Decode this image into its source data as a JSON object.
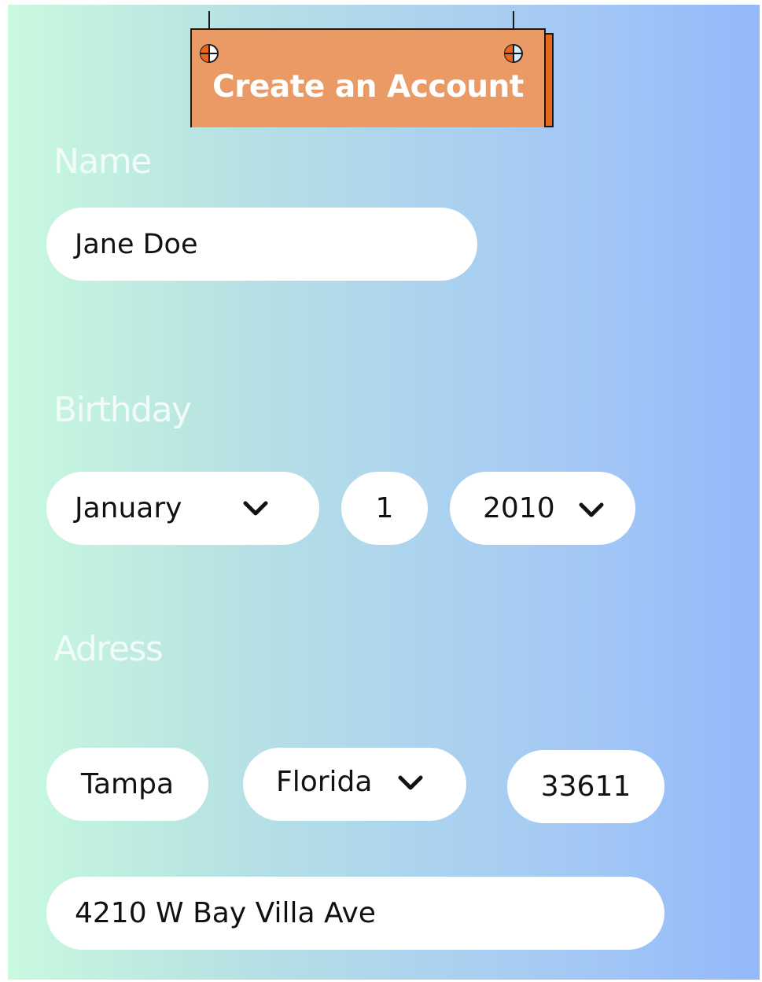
{
  "header": {
    "title": "Create an Account"
  },
  "form": {
    "name": {
      "label": "Name",
      "value": "Jane Doe"
    },
    "birthday": {
      "label": "Birthday",
      "month": "January",
      "day": "1",
      "year": "2010"
    },
    "address": {
      "label": "Adress",
      "city": "Tampa",
      "state": "Florida",
      "zip": "33611",
      "street": "4210 W Bay Villa Ave"
    }
  },
  "icons": {
    "dropdown": "chevron-down-icon",
    "pin": "pin-icon"
  },
  "colors": {
    "gradient_start": "#c9f9df",
    "gradient_end": "#93b8fb",
    "banner_fill": "#e99a65",
    "banner_shadow": "#e8671d",
    "label_text": "#f1fbf8",
    "field_bg": "#ffffff"
  }
}
